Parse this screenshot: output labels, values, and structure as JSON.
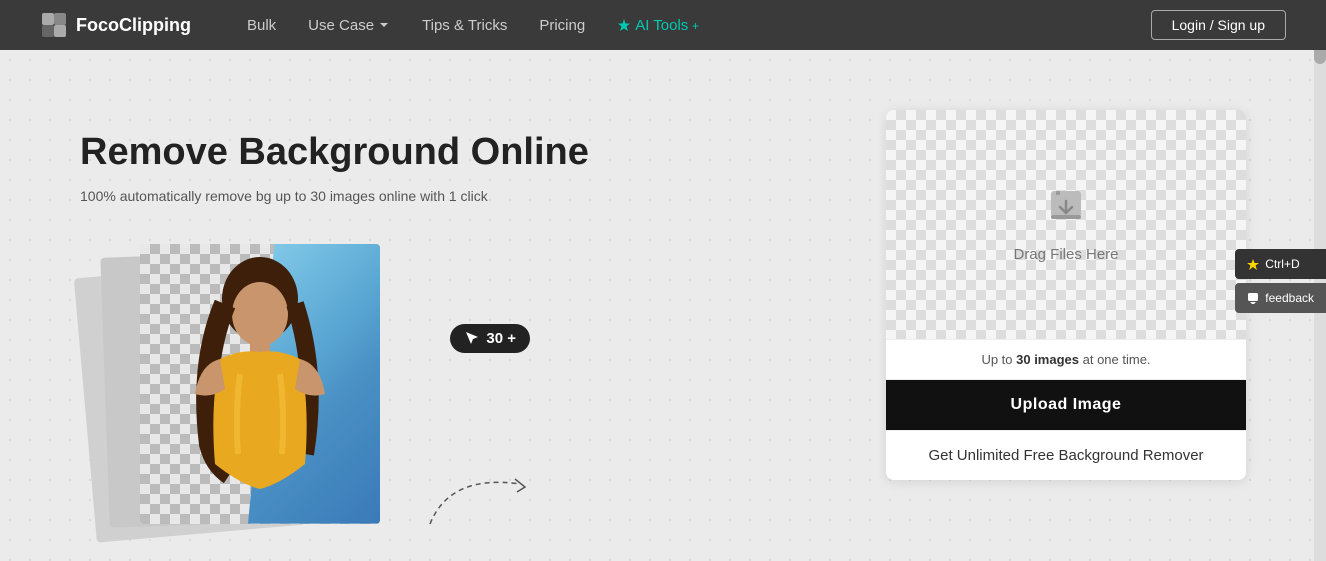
{
  "nav": {
    "logo_text": "FocoClipping",
    "links": {
      "bulk": "Bulk",
      "use_case": "Use Case",
      "tips_tricks": "Tips & Tricks",
      "pricing": "Pricing",
      "ai_tools": "AI Tools",
      "login": "Login / Sign up"
    }
  },
  "hero": {
    "title": "Remove Background Online",
    "subtitle": "100% automatically remove bg up to 30 images online with 1 click",
    "badge": "30 +",
    "drag_text": "Drag Files Here",
    "upload_info_prefix": "Up to ",
    "upload_info_count": "30 images",
    "upload_info_suffix": " at one time.",
    "btn_upload": "Upload Image",
    "btn_unlimited": "Get Unlimited Free Background Remover"
  },
  "floating": {
    "bookmark": "Ctrl+D",
    "feedback": "feedback"
  }
}
